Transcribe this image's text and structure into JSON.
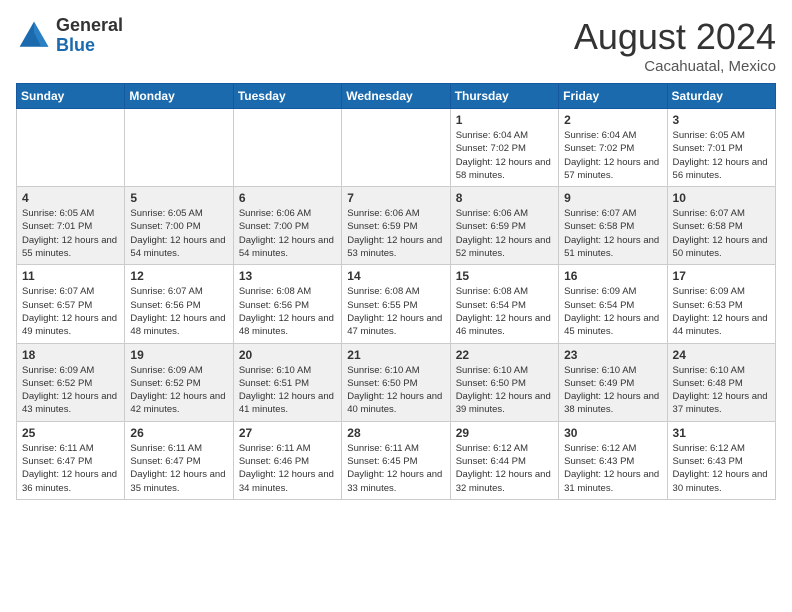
{
  "header": {
    "logo_general": "General",
    "logo_blue": "Blue",
    "month_year": "August 2024",
    "location": "Cacahuatal, Mexico"
  },
  "columns": [
    "Sunday",
    "Monday",
    "Tuesday",
    "Wednesday",
    "Thursday",
    "Friday",
    "Saturday"
  ],
  "weeks": [
    {
      "days": [
        {
          "num": "",
          "info": ""
        },
        {
          "num": "",
          "info": ""
        },
        {
          "num": "",
          "info": ""
        },
        {
          "num": "",
          "info": ""
        },
        {
          "num": "1",
          "info": "Sunrise: 6:04 AM\nSunset: 7:02 PM\nDaylight: 12 hours and 58 minutes."
        },
        {
          "num": "2",
          "info": "Sunrise: 6:04 AM\nSunset: 7:02 PM\nDaylight: 12 hours and 57 minutes."
        },
        {
          "num": "3",
          "info": "Sunrise: 6:05 AM\nSunset: 7:01 PM\nDaylight: 12 hours and 56 minutes."
        }
      ]
    },
    {
      "days": [
        {
          "num": "4",
          "info": "Sunrise: 6:05 AM\nSunset: 7:01 PM\nDaylight: 12 hours and 55 minutes."
        },
        {
          "num": "5",
          "info": "Sunrise: 6:05 AM\nSunset: 7:00 PM\nDaylight: 12 hours and 54 minutes."
        },
        {
          "num": "6",
          "info": "Sunrise: 6:06 AM\nSunset: 7:00 PM\nDaylight: 12 hours and 54 minutes."
        },
        {
          "num": "7",
          "info": "Sunrise: 6:06 AM\nSunset: 6:59 PM\nDaylight: 12 hours and 53 minutes."
        },
        {
          "num": "8",
          "info": "Sunrise: 6:06 AM\nSunset: 6:59 PM\nDaylight: 12 hours and 52 minutes."
        },
        {
          "num": "9",
          "info": "Sunrise: 6:07 AM\nSunset: 6:58 PM\nDaylight: 12 hours and 51 minutes."
        },
        {
          "num": "10",
          "info": "Sunrise: 6:07 AM\nSunset: 6:58 PM\nDaylight: 12 hours and 50 minutes."
        }
      ]
    },
    {
      "days": [
        {
          "num": "11",
          "info": "Sunrise: 6:07 AM\nSunset: 6:57 PM\nDaylight: 12 hours and 49 minutes."
        },
        {
          "num": "12",
          "info": "Sunrise: 6:07 AM\nSunset: 6:56 PM\nDaylight: 12 hours and 48 minutes."
        },
        {
          "num": "13",
          "info": "Sunrise: 6:08 AM\nSunset: 6:56 PM\nDaylight: 12 hours and 48 minutes."
        },
        {
          "num": "14",
          "info": "Sunrise: 6:08 AM\nSunset: 6:55 PM\nDaylight: 12 hours and 47 minutes."
        },
        {
          "num": "15",
          "info": "Sunrise: 6:08 AM\nSunset: 6:54 PM\nDaylight: 12 hours and 46 minutes."
        },
        {
          "num": "16",
          "info": "Sunrise: 6:09 AM\nSunset: 6:54 PM\nDaylight: 12 hours and 45 minutes."
        },
        {
          "num": "17",
          "info": "Sunrise: 6:09 AM\nSunset: 6:53 PM\nDaylight: 12 hours and 44 minutes."
        }
      ]
    },
    {
      "days": [
        {
          "num": "18",
          "info": "Sunrise: 6:09 AM\nSunset: 6:52 PM\nDaylight: 12 hours and 43 minutes."
        },
        {
          "num": "19",
          "info": "Sunrise: 6:09 AM\nSunset: 6:52 PM\nDaylight: 12 hours and 42 minutes."
        },
        {
          "num": "20",
          "info": "Sunrise: 6:10 AM\nSunset: 6:51 PM\nDaylight: 12 hours and 41 minutes."
        },
        {
          "num": "21",
          "info": "Sunrise: 6:10 AM\nSunset: 6:50 PM\nDaylight: 12 hours and 40 minutes."
        },
        {
          "num": "22",
          "info": "Sunrise: 6:10 AM\nSunset: 6:50 PM\nDaylight: 12 hours and 39 minutes."
        },
        {
          "num": "23",
          "info": "Sunrise: 6:10 AM\nSunset: 6:49 PM\nDaylight: 12 hours and 38 minutes."
        },
        {
          "num": "24",
          "info": "Sunrise: 6:10 AM\nSunset: 6:48 PM\nDaylight: 12 hours and 37 minutes."
        }
      ]
    },
    {
      "days": [
        {
          "num": "25",
          "info": "Sunrise: 6:11 AM\nSunset: 6:47 PM\nDaylight: 12 hours and 36 minutes."
        },
        {
          "num": "26",
          "info": "Sunrise: 6:11 AM\nSunset: 6:47 PM\nDaylight: 12 hours and 35 minutes."
        },
        {
          "num": "27",
          "info": "Sunrise: 6:11 AM\nSunset: 6:46 PM\nDaylight: 12 hours and 34 minutes."
        },
        {
          "num": "28",
          "info": "Sunrise: 6:11 AM\nSunset: 6:45 PM\nDaylight: 12 hours and 33 minutes."
        },
        {
          "num": "29",
          "info": "Sunrise: 6:12 AM\nSunset: 6:44 PM\nDaylight: 12 hours and 32 minutes."
        },
        {
          "num": "30",
          "info": "Sunrise: 6:12 AM\nSunset: 6:43 PM\nDaylight: 12 hours and 31 minutes."
        },
        {
          "num": "31",
          "info": "Sunrise: 6:12 AM\nSunset: 6:43 PM\nDaylight: 12 hours and 30 minutes."
        }
      ]
    }
  ]
}
